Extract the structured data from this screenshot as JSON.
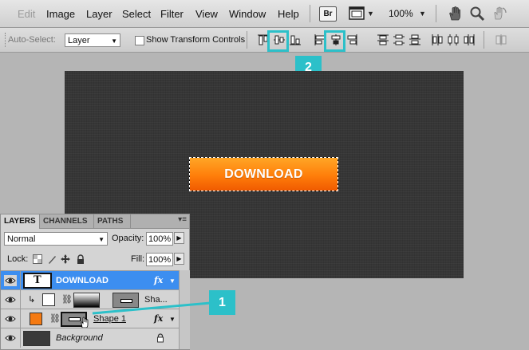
{
  "menu": {
    "items": [
      {
        "label": "Edit",
        "enabled": false
      },
      {
        "label": "Image",
        "enabled": true
      },
      {
        "label": "Layer",
        "enabled": true
      },
      {
        "label": "Select",
        "enabled": true
      },
      {
        "label": "Filter",
        "enabled": true
      },
      {
        "label": "View",
        "enabled": true
      },
      {
        "label": "Window",
        "enabled": true
      },
      {
        "label": "Help",
        "enabled": true
      }
    ],
    "bridge_label": "Br",
    "zoom": "100%",
    "icons": [
      "hand-icon",
      "zoom-icon",
      "rotate-view-icon"
    ]
  },
  "options": {
    "auto_select_label": "Auto-Select:",
    "auto_select_value": "Layer",
    "show_transform_label": "Show Transform Controls",
    "align_icons": [
      "align-top-edges-icon",
      "align-vertical-centers-icon",
      "align-bottom-edges-icon",
      "align-left-edges-icon",
      "align-horizontal-centers-icon",
      "align-right-edges-icon",
      "distribute-top-icon",
      "distribute-vertical-centers-icon",
      "distribute-bottom-icon",
      "distribute-left-icon",
      "distribute-horizontal-centers-icon",
      "distribute-right-icon",
      "auto-align-icon"
    ]
  },
  "callouts": {
    "one": "1",
    "two": "2"
  },
  "accent_color": "#2cc0c9",
  "canvas": {
    "button_text": "DOWNLOAD"
  },
  "layers_panel": {
    "tabs": [
      "LAYERS",
      "CHANNELS",
      "PATHS"
    ],
    "blend_mode": "Normal",
    "opacity_label": "Opacity:",
    "opacity_value": "100%",
    "lock_label": "Lock:",
    "fill_label": "Fill:",
    "fill_value": "100%",
    "layers": [
      {
        "name": "DOWNLOAD",
        "type": "text",
        "selected": true,
        "fx": "fx"
      },
      {
        "name": "Sha...",
        "type": "clipped-shape",
        "selected": false
      },
      {
        "name": "Shape 1",
        "type": "shape",
        "selected": false,
        "fx": "fx",
        "color": "#f57a12"
      },
      {
        "name": "Background",
        "type": "background",
        "selected": false
      }
    ]
  }
}
